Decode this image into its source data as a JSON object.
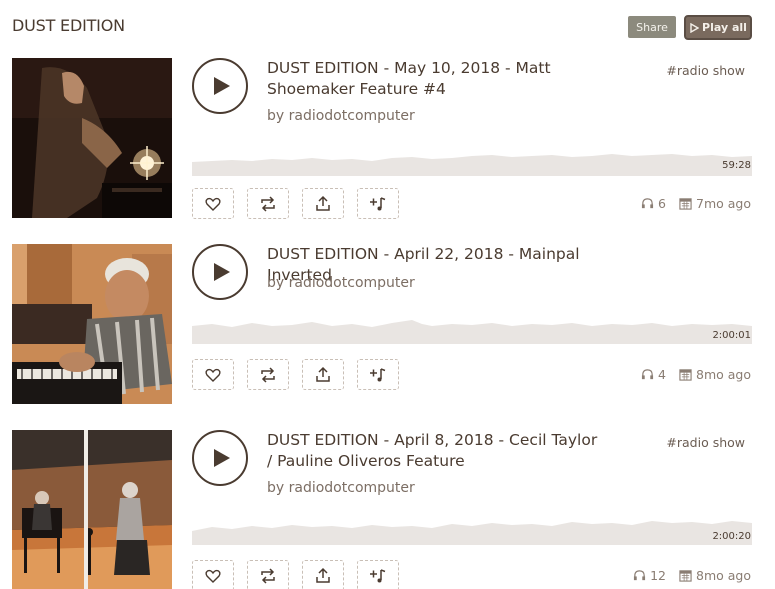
{
  "header": {
    "title": "DUST EDITION",
    "share_label": "Share",
    "playall_label": "Play all"
  },
  "colors": {
    "text": "#4a3b30",
    "muted": "#7c6e64",
    "share_bg": "#8c8a7d",
    "playall_bg": "#7a6a5e",
    "waveform": "#e4dfdb"
  },
  "tracks": [
    {
      "title": "DUST EDITION - May 10, 2018 - Matt Shoemaker Feature #4",
      "by": "by radiodotcomputer",
      "tag": "#radio show",
      "duration": "59:28",
      "plays": "6",
      "age": "7mo ago",
      "cover_icon": "dj-performer-photo"
    },
    {
      "title": "DUST EDITION - April 22, 2018 - Mainpal Inverted",
      "by": "by radiodotcomputer",
      "tag": "",
      "duration": "2:00:01",
      "plays": "4",
      "age": "8mo ago",
      "cover_icon": "keyboard-player-photo"
    },
    {
      "title": "DUST EDITION - April 8, 2018 - Cecil Taylor / Pauline Oliveros Feature",
      "by": "by radiodotcomputer",
      "tag": "#radio show",
      "duration": "2:00:20",
      "plays": "12",
      "age": "8mo ago",
      "cover_icon": "stage-performers-photo"
    }
  ],
  "icons": [
    "play-icon",
    "heart-icon",
    "repost-icon",
    "share-icon",
    "add-to-playlist-icon",
    "headphones-icon",
    "calendar-icon"
  ]
}
